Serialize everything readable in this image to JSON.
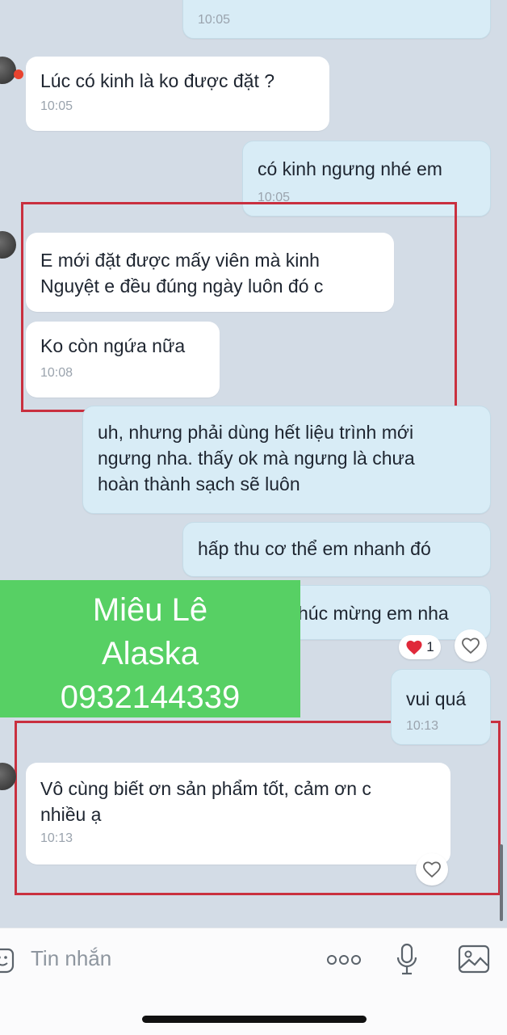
{
  "messages": [
    {
      "id": "m0",
      "time": "10:05"
    },
    {
      "id": "m1",
      "text": "Lúc có kinh là ko được đặt ?",
      "time": "10:05"
    },
    {
      "id": "m2",
      "text": "có kinh ngưng nhé em",
      "time": "10:05"
    },
    {
      "id": "m3",
      "line1": "E mới đặt được mấy viên mà kinh",
      "line2": "Nguyệt e đều đúng ngày luôn đó c"
    },
    {
      "id": "m4",
      "text": "Ko còn ngứa nữa",
      "time": "10:08"
    },
    {
      "id": "m5",
      "line1": "uh, nhưng phải dùng hết liệu trình mới",
      "line2": "ngưng nha. thấy ok mà ngưng là chưa",
      "line3": "hoàn thành sạch sẽ luôn"
    },
    {
      "id": "m6",
      "text": "hấp thu cơ thể em nhanh đó"
    },
    {
      "id": "m7",
      "text": "húc mừng em nha",
      "reaction_count": "1"
    },
    {
      "id": "m8",
      "text": "vui quá",
      "time": "10:13"
    },
    {
      "id": "m9",
      "line1": "Vô cùng biết ơn sản phẩm tốt, cảm ơn c",
      "line2": "nhiều ạ",
      "time": "10:13"
    }
  ],
  "overlay": {
    "line1": "Miêu Lê",
    "line2": "Alaska",
    "line3": "0932144339"
  },
  "composer": {
    "placeholder": "Tin nhắn"
  },
  "colors": {
    "highlight": "#c9303f",
    "overlay": "#57d064",
    "outgoing": "#d8ecf6"
  }
}
